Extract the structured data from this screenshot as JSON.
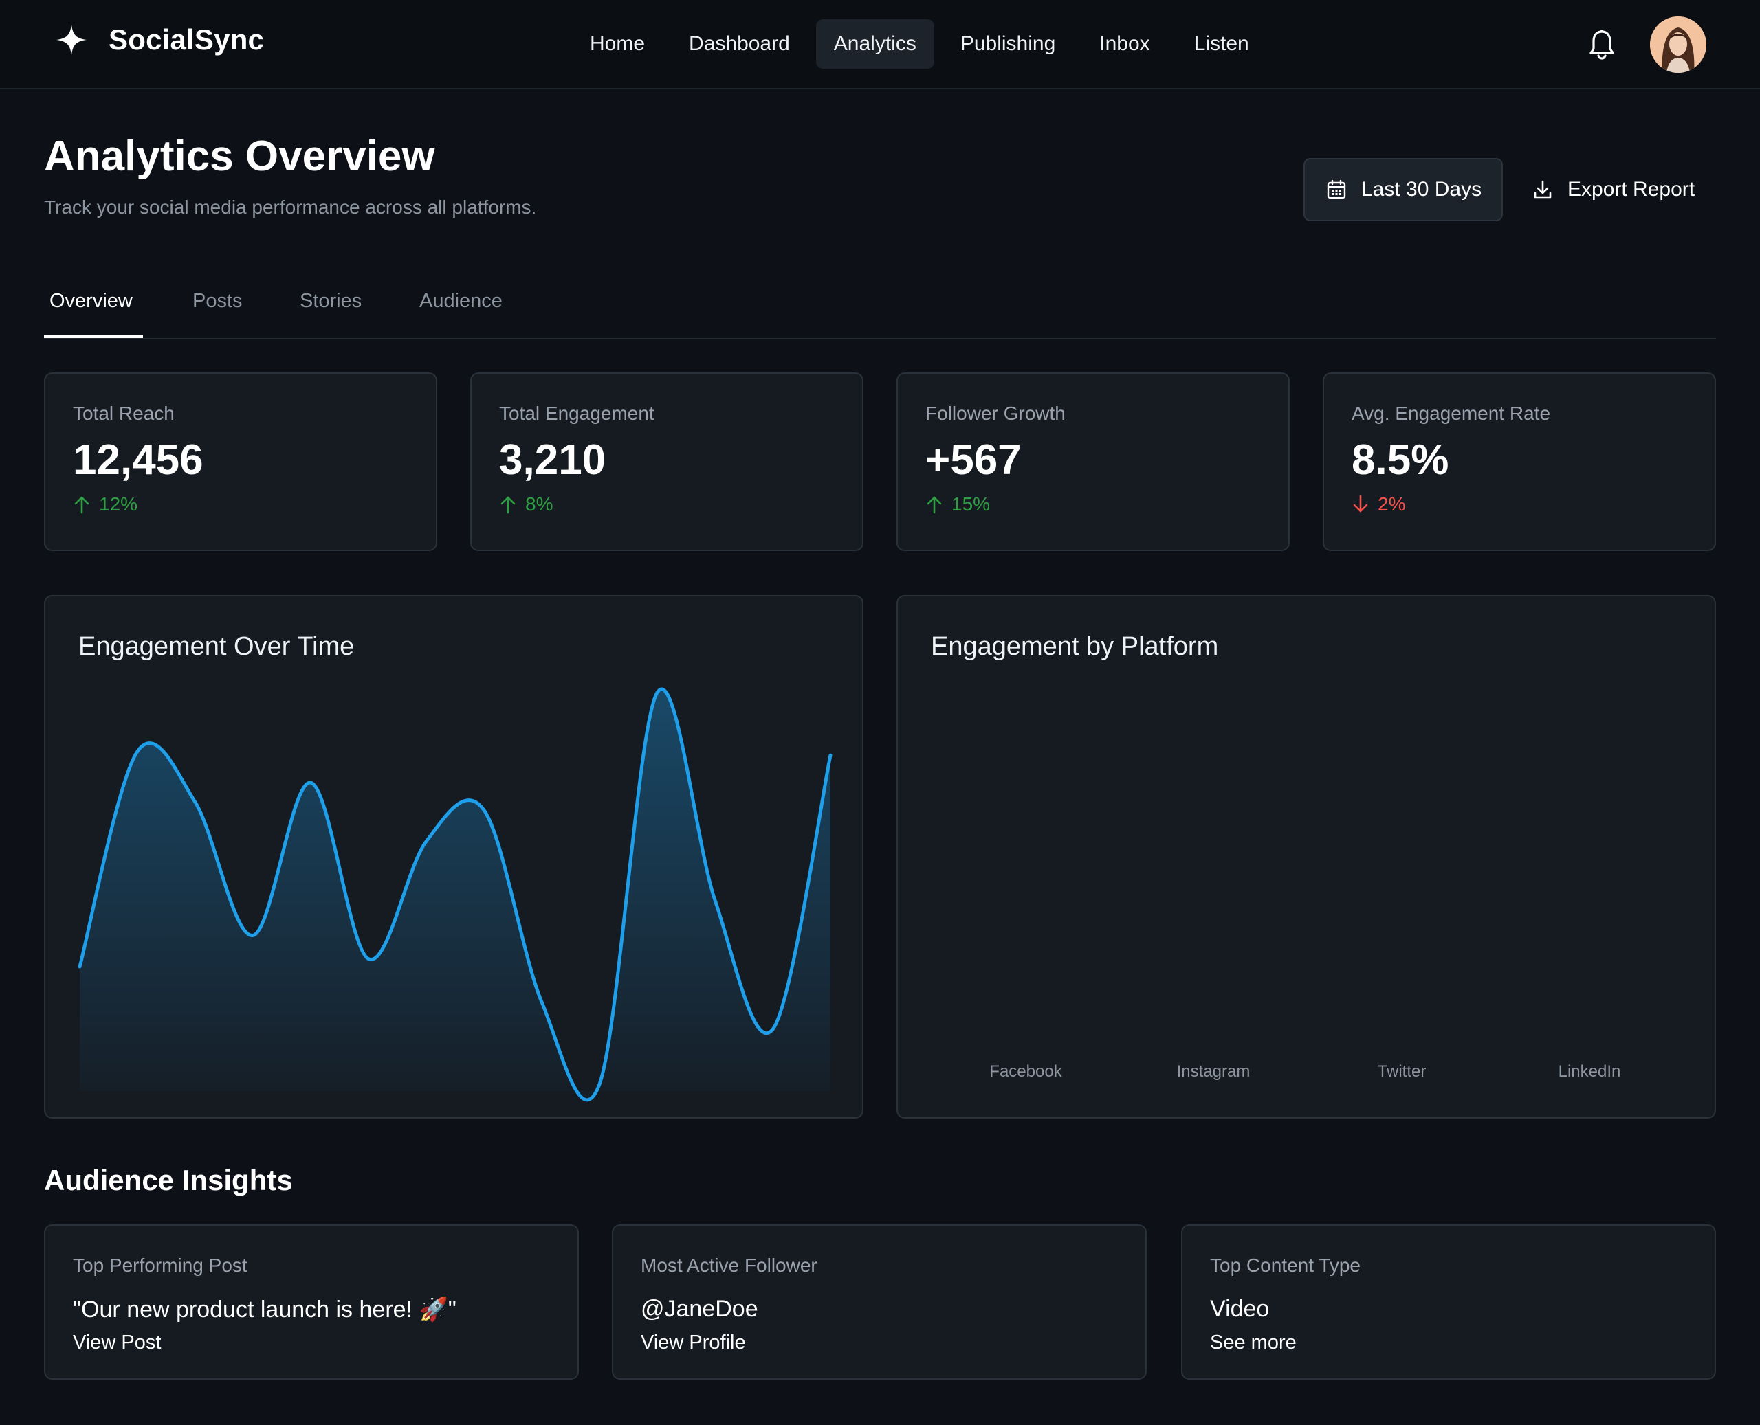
{
  "app": {
    "name": "SocialSync",
    "brand_icon": "sparkle-icon"
  },
  "nav": {
    "items": [
      {
        "label": "Home"
      },
      {
        "label": "Dashboard"
      },
      {
        "label": "Analytics",
        "active": true
      },
      {
        "label": "Publishing"
      },
      {
        "label": "Inbox"
      },
      {
        "label": "Listen"
      }
    ],
    "notification_icon": "bell-icon"
  },
  "header": {
    "title": "Analytics Overview",
    "subtitle": "Track your social media performance across all platforms.",
    "date_range_label": "Last 30 Days",
    "export_label": "Export Report"
  },
  "tabs": [
    {
      "label": "Overview",
      "active": true
    },
    {
      "label": "Posts"
    },
    {
      "label": "Stories"
    },
    {
      "label": "Audience"
    }
  ],
  "stats": [
    {
      "label": "Total Reach",
      "value": "12,456",
      "delta": "12%",
      "direction": "up"
    },
    {
      "label": "Total Engagement",
      "value": "3,210",
      "delta": "8%",
      "direction": "up"
    },
    {
      "label": "Follower Growth",
      "value": "+567",
      "delta": "15%",
      "direction": "up"
    },
    {
      "label": "Avg. Engagement Rate",
      "value": "8.5%",
      "delta": "2%",
      "direction": "down"
    }
  ],
  "chart_data": [
    {
      "type": "area",
      "title": "Engagement Over Time",
      "values": [
        30,
        85,
        72,
        38,
        77,
        32,
        62,
        70,
        21,
        0,
        100,
        47,
        14,
        84
      ],
      "ylim": [
        0,
        100
      ],
      "grid": false,
      "color": "#1f9eea"
    },
    {
      "type": "bar",
      "title": "Engagement by Platform",
      "categories": [
        "Facebook",
        "Instagram",
        "Twitter",
        "LinkedIn"
      ]
    }
  ],
  "insights": {
    "title": "Audience Insights",
    "cards": [
      {
        "label": "Top Performing Post",
        "value": "\"Our new product launch is here! 🚀\"",
        "link": "View Post"
      },
      {
        "label": "Most Active Follower",
        "value": "@JaneDoe",
        "link": "View Profile"
      },
      {
        "label": "Top Content Type",
        "value": "Video",
        "link": "See more"
      }
    ]
  },
  "colors": {
    "background": "#0d1117",
    "card": "#161b22",
    "positive": "#2ea043",
    "negative": "#f85149",
    "accent": "#1f9eea"
  }
}
